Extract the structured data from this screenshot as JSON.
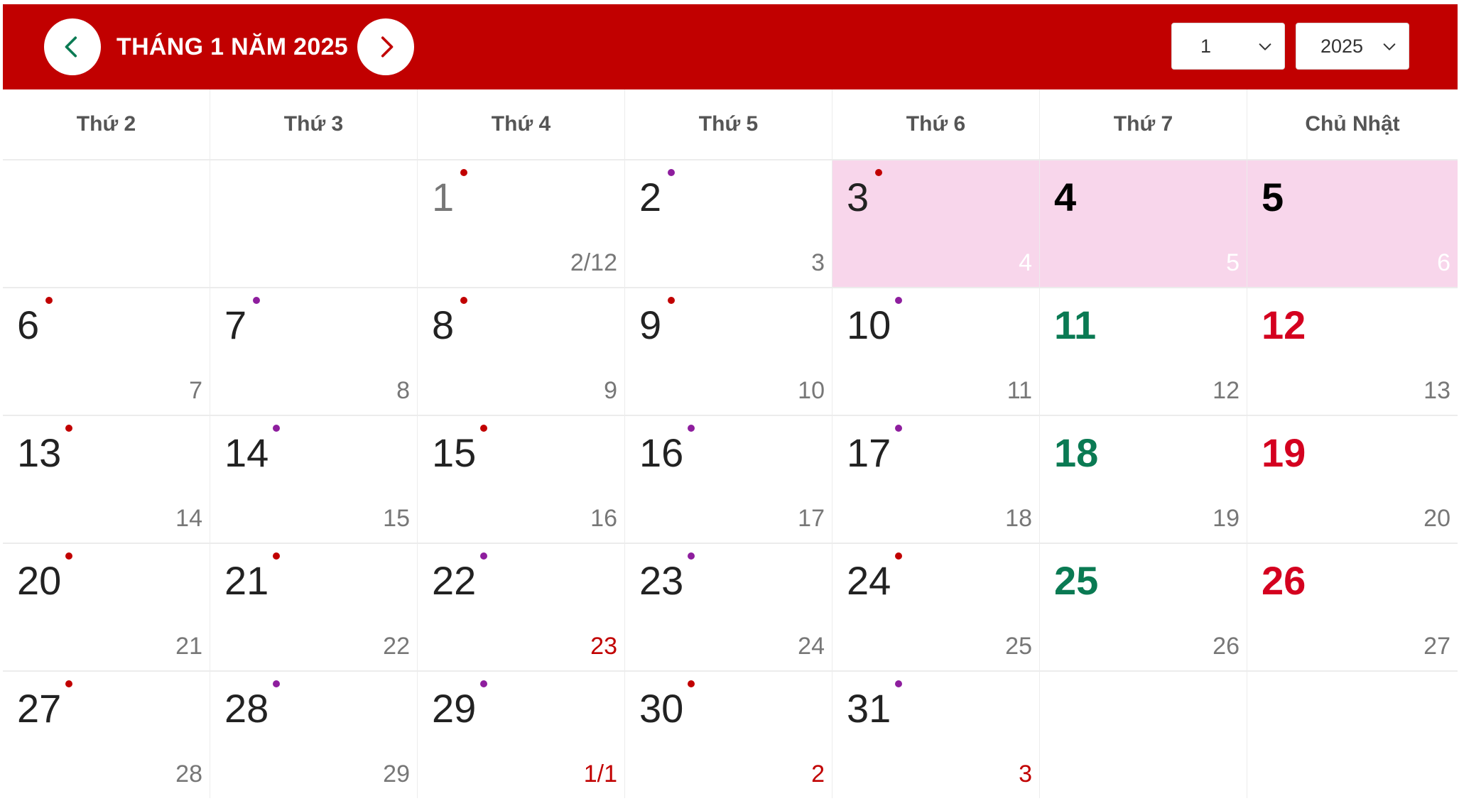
{
  "header": {
    "title": "THÁNG 1 NĂM 2025",
    "month_select": "1",
    "year_select": "2025",
    "colors": {
      "bar": "#c10000",
      "prev_arrow": "#0a7a53",
      "next_arrow": "#c10000"
    }
  },
  "weekdays": [
    "Thứ 2",
    "Thứ 3",
    "Thứ 4",
    "Thứ 5",
    "Thứ 6",
    "Thứ 7",
    "Chủ Nhật"
  ],
  "weeks": [
    [
      null,
      null,
      {
        "solar": "1",
        "lunar": "2/12",
        "dot": "red",
        "style": "first",
        "lunar_style": "gray"
      },
      {
        "solar": "2",
        "lunar": "3",
        "dot": "purple",
        "style": "normal",
        "lunar_style": "gray"
      },
      {
        "solar": "3",
        "lunar": "4",
        "dot": "red",
        "style": "normal",
        "lunar_style": "white",
        "highlight": true
      },
      {
        "solar": "4",
        "lunar": "5",
        "dot": null,
        "style": "bold",
        "lunar_style": "white",
        "highlight": true
      },
      {
        "solar": "5",
        "lunar": "6",
        "dot": null,
        "style": "bold",
        "lunar_style": "white",
        "highlight": true
      }
    ],
    [
      {
        "solar": "6",
        "lunar": "7",
        "dot": "red",
        "style": "normal",
        "lunar_style": "gray"
      },
      {
        "solar": "7",
        "lunar": "8",
        "dot": "purple",
        "style": "normal",
        "lunar_style": "gray"
      },
      {
        "solar": "8",
        "lunar": "9",
        "dot": "red",
        "style": "normal",
        "lunar_style": "gray"
      },
      {
        "solar": "9",
        "lunar": "10",
        "dot": "red",
        "style": "normal",
        "lunar_style": "gray"
      },
      {
        "solar": "10",
        "lunar": "11",
        "dot": "purple",
        "style": "normal",
        "lunar_style": "gray"
      },
      {
        "solar": "11",
        "lunar": "12",
        "dot": null,
        "style": "sat",
        "lunar_style": "gray"
      },
      {
        "solar": "12",
        "lunar": "13",
        "dot": null,
        "style": "sun",
        "lunar_style": "gray"
      }
    ],
    [
      {
        "solar": "13",
        "lunar": "14",
        "dot": "red",
        "style": "normal",
        "lunar_style": "gray"
      },
      {
        "solar": "14",
        "lunar": "15",
        "dot": "purple",
        "style": "normal",
        "lunar_style": "gray"
      },
      {
        "solar": "15",
        "lunar": "16",
        "dot": "red",
        "style": "normal",
        "lunar_style": "gray"
      },
      {
        "solar": "16",
        "lunar": "17",
        "dot": "purple",
        "style": "normal",
        "lunar_style": "gray"
      },
      {
        "solar": "17",
        "lunar": "18",
        "dot": "purple",
        "style": "normal",
        "lunar_style": "gray"
      },
      {
        "solar": "18",
        "lunar": "19",
        "dot": null,
        "style": "sat",
        "lunar_style": "gray"
      },
      {
        "solar": "19",
        "lunar": "20",
        "dot": null,
        "style": "sun",
        "lunar_style": "gray"
      }
    ],
    [
      {
        "solar": "20",
        "lunar": "21",
        "dot": "red",
        "style": "normal",
        "lunar_style": "gray"
      },
      {
        "solar": "21",
        "lunar": "22",
        "dot": "red",
        "style": "normal",
        "lunar_style": "gray"
      },
      {
        "solar": "22",
        "lunar": "23",
        "dot": "purple",
        "style": "normal",
        "lunar_style": "red"
      },
      {
        "solar": "23",
        "lunar": "24",
        "dot": "purple",
        "style": "normal",
        "lunar_style": "gray"
      },
      {
        "solar": "24",
        "lunar": "25",
        "dot": "red",
        "style": "normal",
        "lunar_style": "gray"
      },
      {
        "solar": "25",
        "lunar": "26",
        "dot": null,
        "style": "sat",
        "lunar_style": "gray"
      },
      {
        "solar": "26",
        "lunar": "27",
        "dot": null,
        "style": "sun",
        "lunar_style": "gray"
      }
    ],
    [
      {
        "solar": "27",
        "lunar": "28",
        "dot": "red",
        "style": "normal",
        "lunar_style": "gray"
      },
      {
        "solar": "28",
        "lunar": "29",
        "dot": "purple",
        "style": "normal",
        "lunar_style": "gray"
      },
      {
        "solar": "29",
        "lunar": "1/1",
        "dot": "purple",
        "style": "normal",
        "lunar_style": "red"
      },
      {
        "solar": "30",
        "lunar": "2",
        "dot": "red",
        "style": "normal",
        "lunar_style": "red"
      },
      {
        "solar": "31",
        "lunar": "3",
        "dot": "purple",
        "style": "normal",
        "lunar_style": "red"
      },
      null,
      null
    ]
  ]
}
